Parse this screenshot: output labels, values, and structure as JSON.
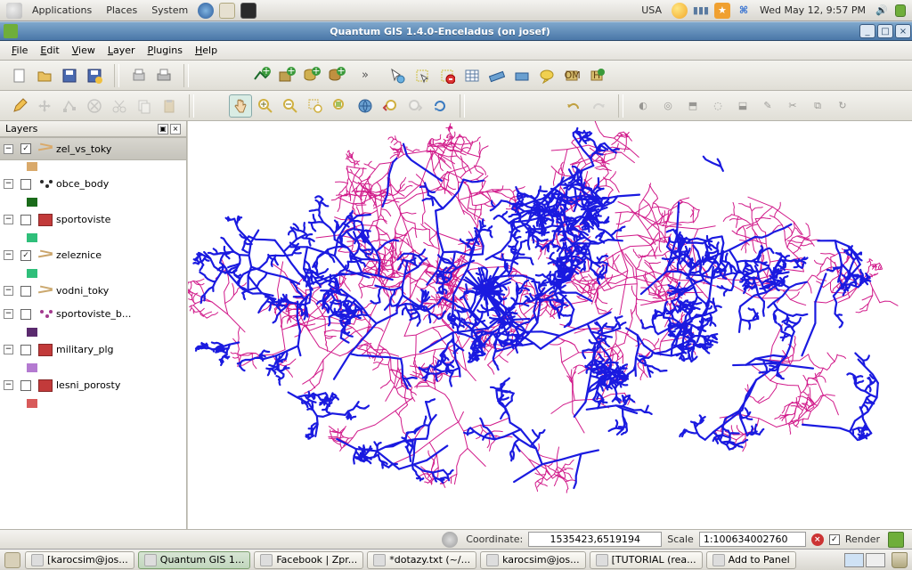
{
  "gnome_panel": {
    "menus": [
      "Applications",
      "Places",
      "System"
    ],
    "keyboard": "USA",
    "clock": "Wed May 12,  9:57 PM"
  },
  "titlebar": {
    "title": "Quantum GIS 1.4.0-Enceladus (on josef)"
  },
  "menubar": {
    "items": [
      "File",
      "Edit",
      "View",
      "Layer",
      "Plugins",
      "Help"
    ]
  },
  "layers_panel": {
    "title": "Layers",
    "items": [
      {
        "name": "zel_vs_toky",
        "checked": true,
        "selected": true,
        "type": "line",
        "color": "#d9a96a",
        "sub_color": "#d9a96a"
      },
      {
        "name": "obce_body",
        "checked": false,
        "selected": false,
        "type": "dots",
        "color": "#2a2a2a",
        "sub_color": "#1a6b1a"
      },
      {
        "name": "sportoviste",
        "checked": false,
        "selected": false,
        "type": "poly",
        "color": "#c23a3a",
        "sub_color": "#2fbf7a"
      },
      {
        "name": "zeleznice",
        "checked": true,
        "selected": false,
        "type": "line",
        "color": "#caa46a",
        "sub_color": "#2fbf7a"
      },
      {
        "name": "vodni_toky",
        "checked": false,
        "selected": false,
        "type": "line",
        "color": "#cba86e",
        "sub_color": null
      },
      {
        "name": "sportoviste_b...",
        "checked": false,
        "selected": false,
        "type": "dots",
        "color": "#a33a8e",
        "sub_color": "#5a2a6e"
      },
      {
        "name": "military_plg",
        "checked": false,
        "selected": false,
        "type": "poly",
        "color": "#c23a3a",
        "sub_color": "#b47ad1"
      },
      {
        "name": "lesni_porosty",
        "checked": false,
        "selected": false,
        "type": "poly",
        "color": "#c23a3a",
        "sub_color": "#d85a5a"
      }
    ]
  },
  "status": {
    "coord_label": "Coordinate:",
    "coordinate": "1535423,6519194",
    "scale_label": "Scale",
    "scale": "1:100634002760",
    "render_label": "Render"
  },
  "taskbar": {
    "items": [
      {
        "label": "[karocsim@jos...",
        "active": false
      },
      {
        "label": "Quantum GIS 1...",
        "active": true
      },
      {
        "label": "Facebook | Zpr...",
        "active": false
      },
      {
        "label": "*dotazy.txt (~/...",
        "active": false
      },
      {
        "label": "karocsim@jos...",
        "active": false
      },
      {
        "label": "[TUTORIAL (rea...",
        "active": false
      },
      {
        "label": "Add to Panel",
        "active": false
      }
    ]
  },
  "map": {
    "layer1_color": "#d11a8a",
    "layer2_color": "#1a1ae0"
  }
}
